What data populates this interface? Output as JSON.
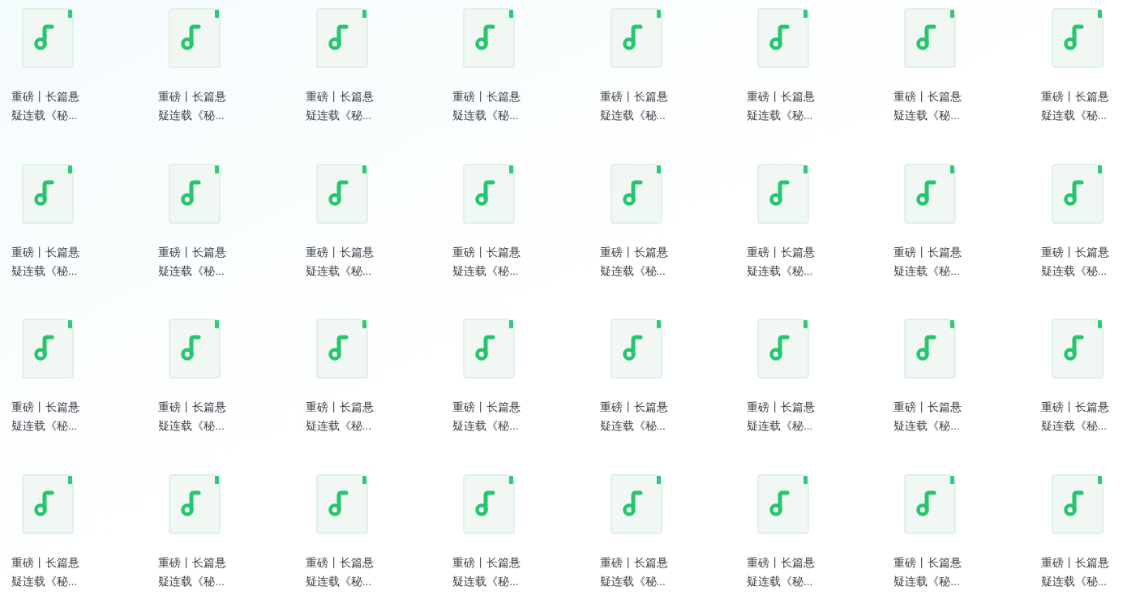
{
  "files": [
    {
      "name": "重磅丨长篇悬疑连载《秘..."
    },
    {
      "name": "重磅丨长篇悬疑连载《秘..."
    },
    {
      "name": "重磅丨长篇悬疑连载《秘..."
    },
    {
      "name": "重磅丨长篇悬疑连载《秘..."
    },
    {
      "name": "重磅丨长篇悬疑连载《秘..."
    },
    {
      "name": "重磅丨长篇悬疑连载《秘..."
    },
    {
      "name": "重磅丨长篇悬疑连载《秘..."
    },
    {
      "name": "重磅丨长篇悬疑连载《秘..."
    },
    {
      "name": "重磅丨长篇悬疑连载《秘..."
    },
    {
      "name": "重磅丨长篇悬疑连载《秘..."
    },
    {
      "name": "重磅丨长篇悬疑连载《秘..."
    },
    {
      "name": "重磅丨长篇悬疑连载《秘..."
    },
    {
      "name": "重磅丨长篇悬疑连载《秘..."
    },
    {
      "name": "重磅丨长篇悬疑连载《秘..."
    },
    {
      "name": "重磅丨长篇悬疑连载《秘..."
    },
    {
      "name": "重磅丨长篇悬疑连载《秘..."
    },
    {
      "name": "重磅丨长篇悬疑连载《秘..."
    },
    {
      "name": "重磅丨长篇悬疑连载《秘..."
    },
    {
      "name": "重磅丨长篇悬疑连载《秘..."
    },
    {
      "name": "重磅丨长篇悬疑连载《秘..."
    },
    {
      "name": "重磅丨长篇悬疑连载《秘..."
    },
    {
      "name": "重磅丨长篇悬疑连载《秘..."
    },
    {
      "name": "重磅丨长篇悬疑连载《秘..."
    },
    {
      "name": "重磅丨长篇悬疑连载《秘..."
    },
    {
      "name": "重磅丨长篇悬疑连载《秘..."
    },
    {
      "name": "重磅丨长篇悬疑连载《秘..."
    },
    {
      "name": "重磅丨长篇悬疑连载《秘..."
    },
    {
      "name": "重磅丨长篇悬疑连载《秘..."
    },
    {
      "name": "重磅丨长篇悬疑连载《秘..."
    },
    {
      "name": "重磅丨长篇悬疑连载《秘..."
    },
    {
      "name": "重磅丨长篇悬疑连载《秘..."
    },
    {
      "name": "重磅丨长篇悬疑连载《秘..."
    }
  ]
}
